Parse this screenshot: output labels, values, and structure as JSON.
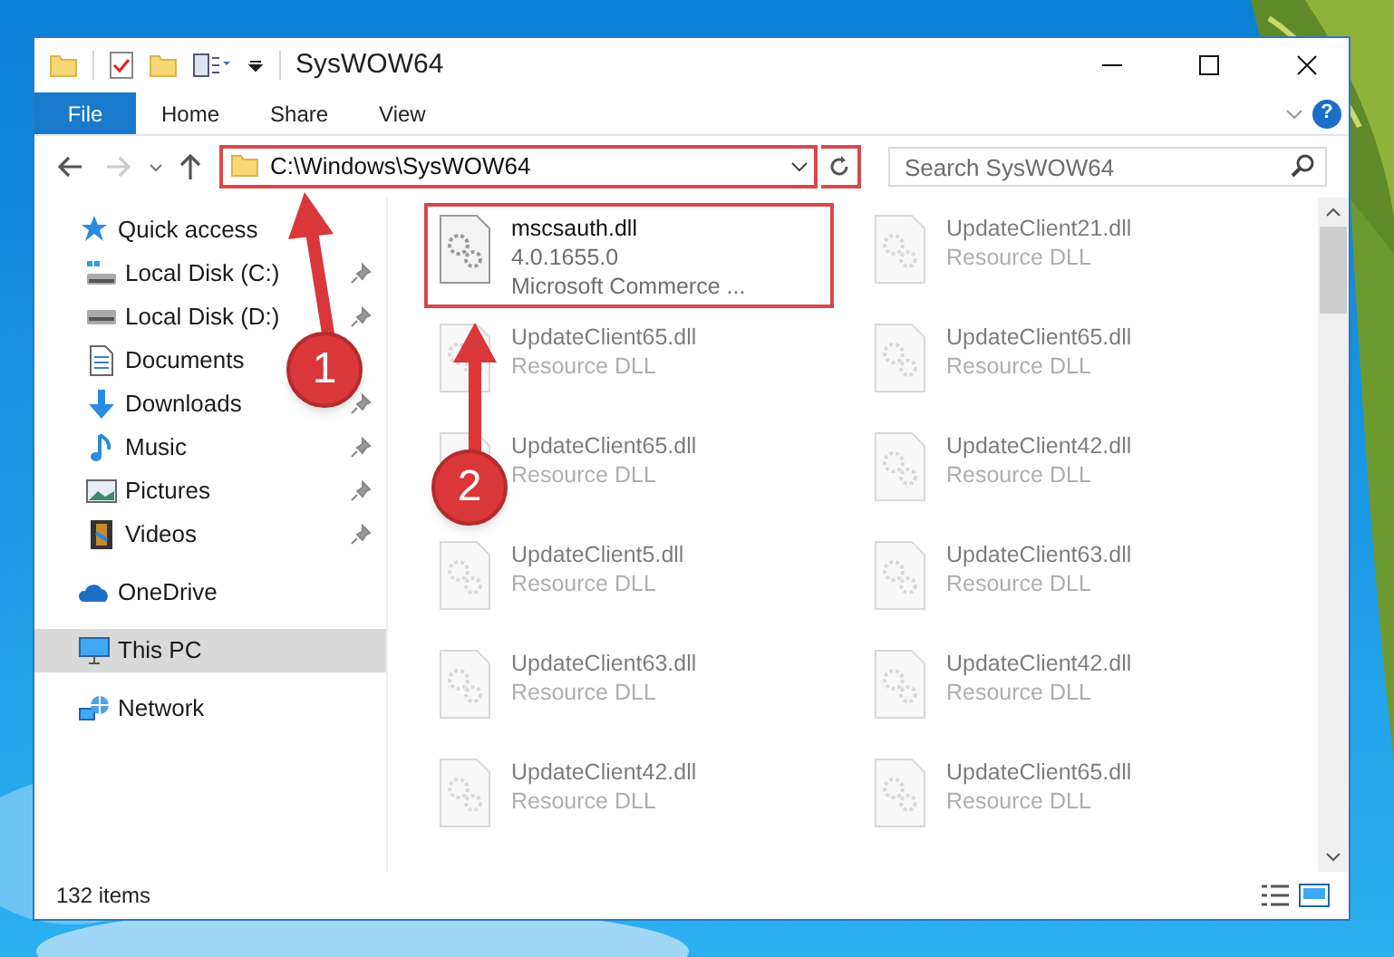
{
  "window": {
    "title": "SysWOW64"
  },
  "ribbon": {
    "tabs": [
      {
        "label": "File",
        "kind": "file"
      },
      {
        "label": "Home",
        "kind": "tab"
      },
      {
        "label": "Share",
        "kind": "tab"
      },
      {
        "label": "View",
        "kind": "tab"
      }
    ],
    "help": "?"
  },
  "navigation": {
    "back_disabled": false,
    "forward_disabled": true
  },
  "address_bar": {
    "value": "C:\\Windows\\SysWOW64",
    "highlighted": true
  },
  "search": {
    "placeholder": "Search SysWOW64"
  },
  "sidebar": {
    "items": [
      {
        "label": "Quick access",
        "selected": false,
        "children": [
          {
            "label": "Local Disk (C:)",
            "pinned": true,
            "selected": false
          },
          {
            "label": "Local Disk (D:)",
            "pinned": true,
            "selected": false
          },
          {
            "label": "Documents",
            "pinned": false,
            "selected": false
          },
          {
            "label": "Downloads",
            "pinned": true,
            "selected": false
          },
          {
            "label": "Music",
            "pinned": true,
            "selected": false
          },
          {
            "label": "Pictures",
            "pinned": true,
            "selected": false
          },
          {
            "label": "Videos",
            "pinned": true,
            "selected": false
          }
        ]
      },
      {
        "label": "OneDrive",
        "selected": false
      },
      {
        "label": "This PC",
        "selected": true
      },
      {
        "label": "Network",
        "selected": false
      }
    ]
  },
  "files": [
    {
      "name": "mscsauth.dll",
      "lines": [
        "4.0.1655.0",
        "Microsoft Commerce ..."
      ],
      "blurred": false,
      "highlighted": true
    },
    {
      "name": "UpdateClient21.dll",
      "lines": [
        "Resource DLL"
      ],
      "blurred": true,
      "highlighted": false
    },
    {
      "name": "UpdateClient65.dll",
      "lines": [
        "Resource DLL"
      ],
      "blurred": true,
      "highlighted": false
    },
    {
      "name": "UpdateClient65.dll",
      "lines": [
        "Resource DLL"
      ],
      "blurred": true,
      "highlighted": false
    },
    {
      "name": "UpdateClient65.dll",
      "lines": [
        "Resource DLL"
      ],
      "blurred": true,
      "highlighted": false
    },
    {
      "name": "UpdateClient42.dll",
      "lines": [
        "Resource DLL"
      ],
      "blurred": true,
      "highlighted": false
    },
    {
      "name": "UpdateClient5.dll",
      "lines": [
        "Resource DLL"
      ],
      "blurred": true,
      "highlighted": false
    },
    {
      "name": "UpdateClient63.dll",
      "lines": [
        "Resource DLL"
      ],
      "blurred": true,
      "highlighted": false
    },
    {
      "name": "UpdateClient63.dll",
      "lines": [
        "Resource DLL"
      ],
      "blurred": true,
      "highlighted": false
    },
    {
      "name": "UpdateClient42.dll",
      "lines": [
        "Resource DLL"
      ],
      "blurred": true,
      "highlighted": false
    },
    {
      "name": "UpdateClient42.dll",
      "lines": [
        "Resource DLL"
      ],
      "blurred": true,
      "highlighted": false
    },
    {
      "name": "UpdateClient65.dll",
      "lines": [
        "Resource DLL"
      ],
      "blurred": true,
      "highlighted": false
    }
  ],
  "status_bar": {
    "item_count": "132 items"
  },
  "annotations": [
    {
      "label": "1"
    },
    {
      "label": "2"
    }
  ]
}
